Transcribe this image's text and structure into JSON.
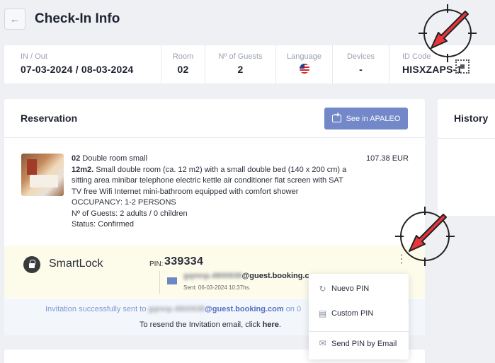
{
  "header": {
    "title": "Check-In Info"
  },
  "info_bar": {
    "inout_label": "IN / Out",
    "inout_value": "07-03-2024 / 08-03-2024",
    "room_label": "Room",
    "room_value": "02",
    "guests_label": "Nº of Guests",
    "guests_value": "2",
    "language_label": "Language",
    "language_flag": "us-flag-icon",
    "devices_label": "Devices",
    "devices_value": "-",
    "id_label": "ID Code",
    "id_value": "HISXZAPS-1"
  },
  "reservation": {
    "title": "Reservation",
    "apaleo_button": "See in APALEO",
    "room_number": "02",
    "room_type": "Double room small",
    "room_size": "12m2.",
    "room_description": "Small double room (ca. 12 m2) with a small double bed (140 x 200 cm) a sitting area minibar telephone electric kettle air conditioner flat screen with SAT TV free Wifi Internet mini-bathroom equipped with comfort shower",
    "occupancy": "OCCUPANCY: 1-2 PERSONS",
    "guests": "Nº of Guests: 2 adults / 0 children",
    "status": "Status: Confirmed",
    "price": "107.38 EUR"
  },
  "smartlock": {
    "title": "SmartLock",
    "pin_label": "PIN:",
    "pin_value": "339334",
    "email_blurred": "gqmnp.4800938",
    "email_domain": "@guest.booking.co",
    "sent": "Sent: 06-03-2024 10:37hs."
  },
  "invitation": {
    "line1_prefix": "Invitation successfully sent to",
    "line1_blurred": "gqmnp.4800938",
    "line1_domain": "@guest.booking.com",
    "line1_suffix": "on 0",
    "line2_prefix": "To resend the Invitation email, click",
    "line2_link": "here",
    "line2_suffix": "."
  },
  "history": {
    "title": "History"
  },
  "dropdown": {
    "items": [
      {
        "label": "Nuevo PIN",
        "icon": "refresh-icon"
      },
      {
        "label": "Custom PIN",
        "icon": "edit-document-icon"
      },
      {
        "label": "Send PIN by Email",
        "icon": "email-icon"
      }
    ]
  },
  "colors": {
    "accent": "#7388c8",
    "pointer_red": "#e8343a",
    "smartlock_bg": "#fdfbea",
    "invite_text": "#7f9ad8"
  }
}
